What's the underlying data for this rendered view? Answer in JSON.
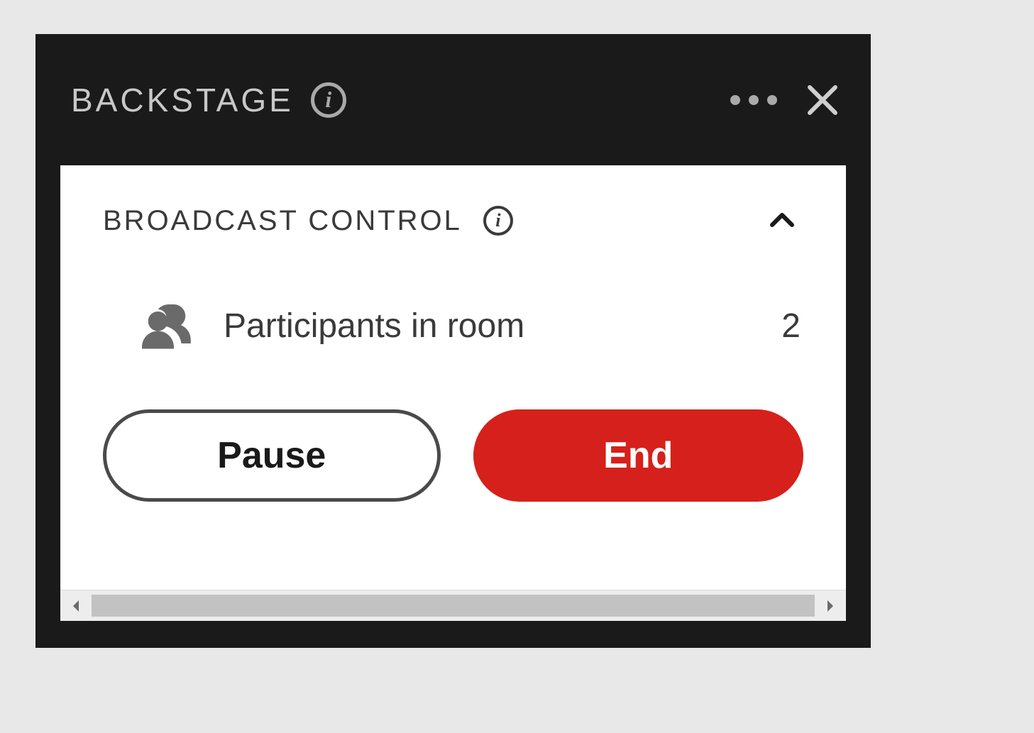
{
  "panel": {
    "title": "BACKSTAGE"
  },
  "section": {
    "title": "BROADCAST CONTROL"
  },
  "participants": {
    "label": "Participants in room",
    "count": "2"
  },
  "buttons": {
    "pause": "Pause",
    "end": "End"
  }
}
